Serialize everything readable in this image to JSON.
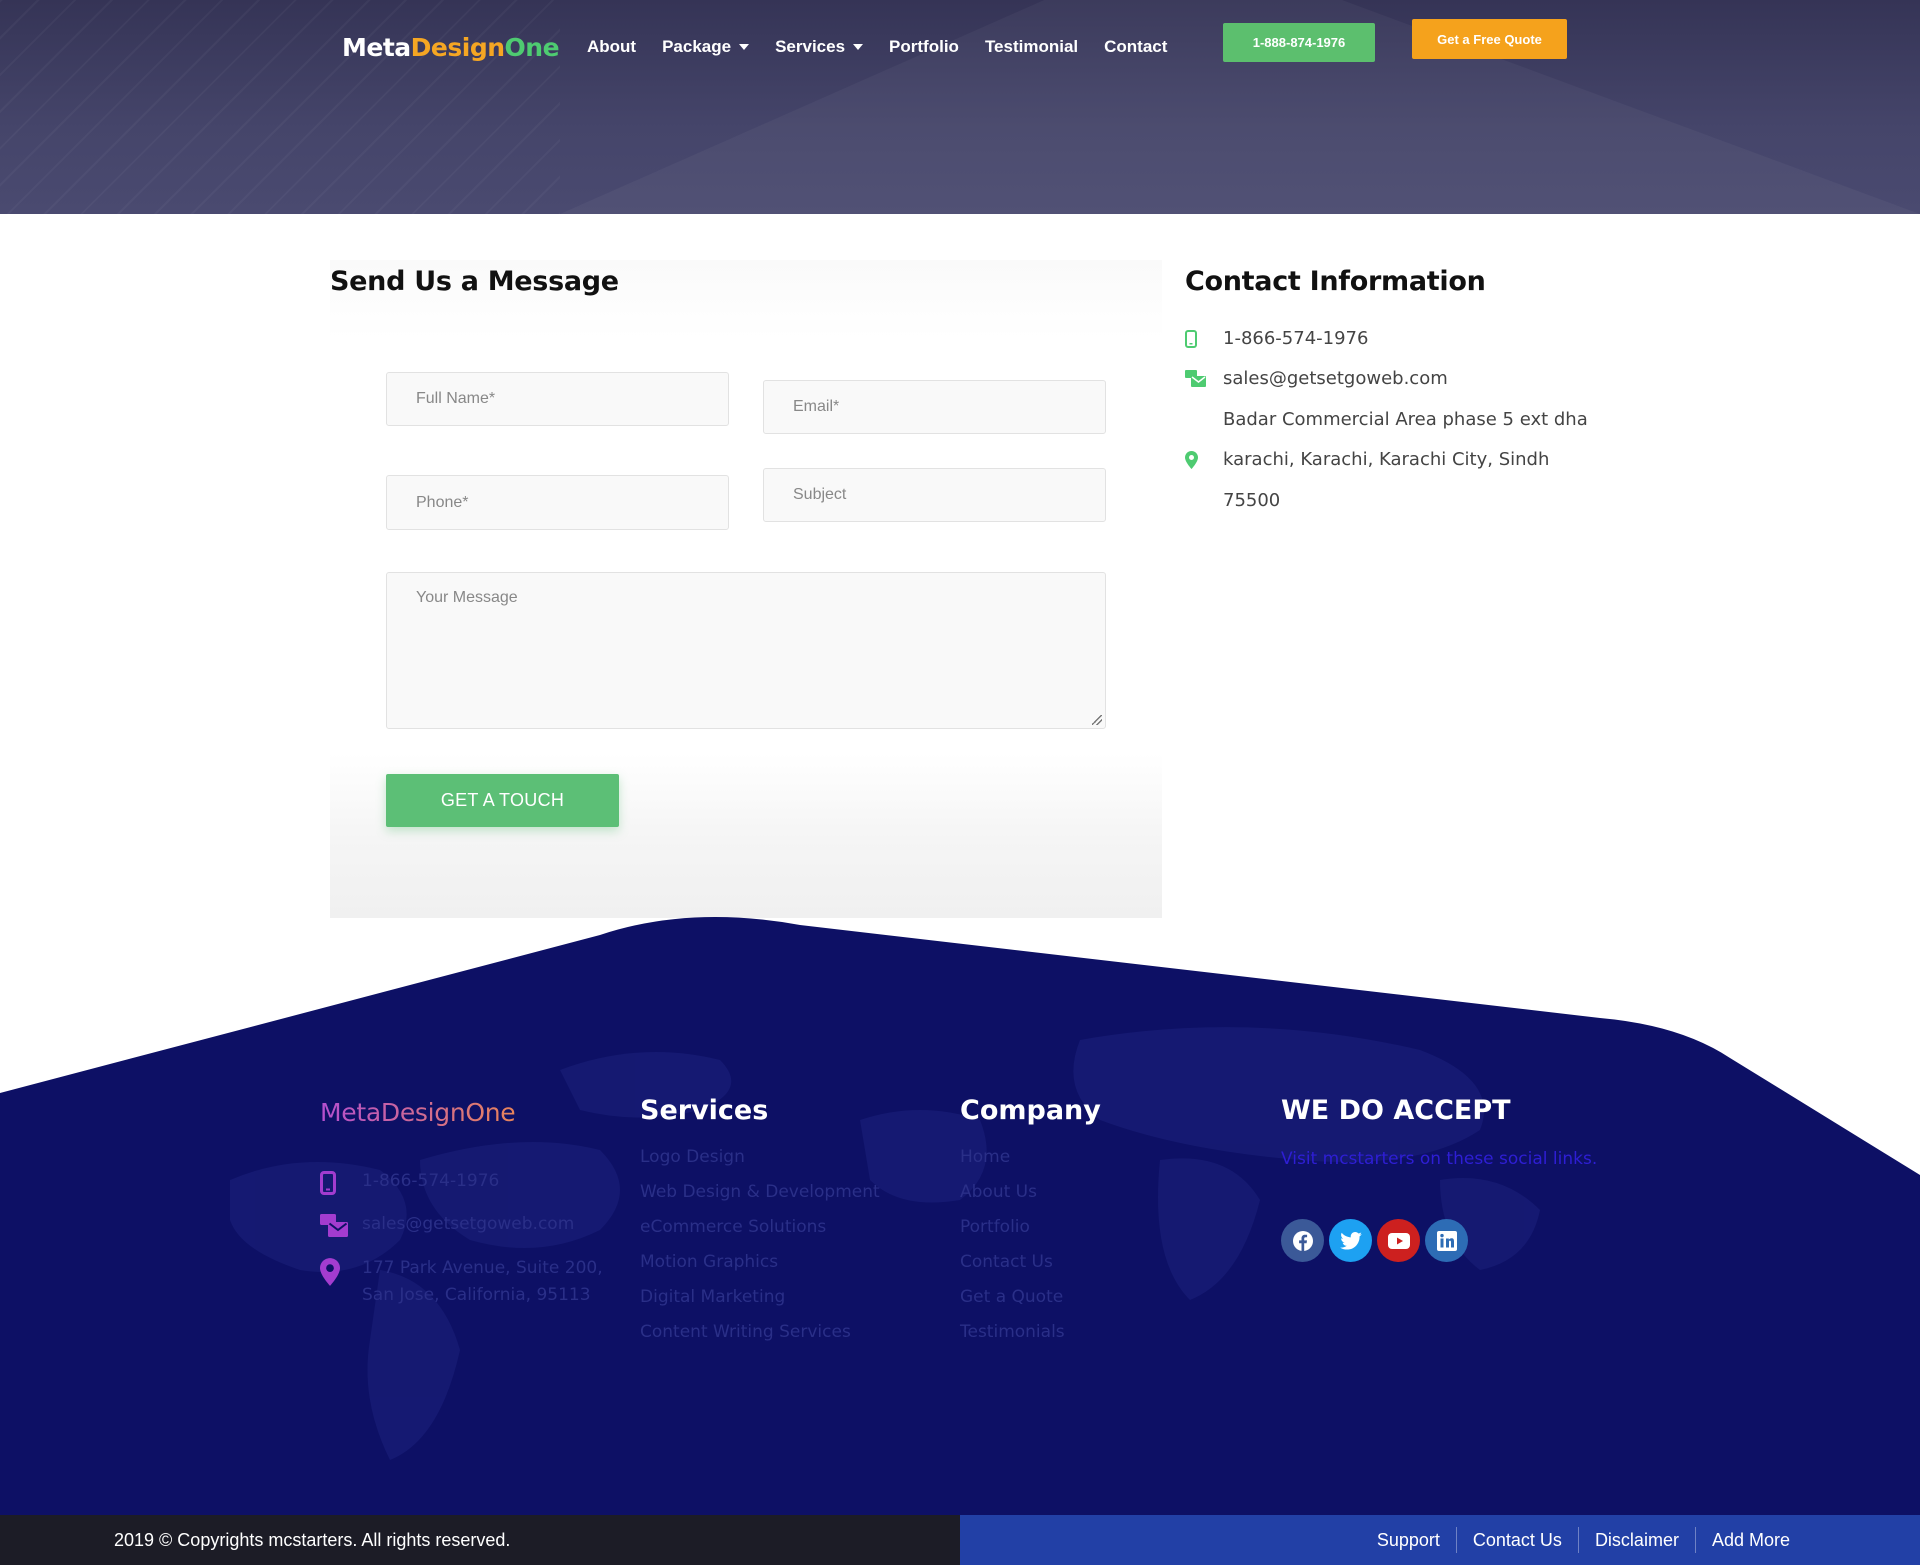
{
  "header": {
    "logo": {
      "part1": "Meta",
      "part2": "Design",
      "part3": "One"
    },
    "nav": [
      {
        "label": "About",
        "dropdown": false
      },
      {
        "label": "Package",
        "dropdown": true
      },
      {
        "label": "Services",
        "dropdown": true
      },
      {
        "label": "Portfolio",
        "dropdown": false
      },
      {
        "label": "Testimonial",
        "dropdown": false
      },
      {
        "label": "Contact",
        "dropdown": false
      }
    ],
    "phone_button": "1-888-874-1976",
    "quote_button": "Get a Free Quote"
  },
  "form": {
    "title": "Send Us a Message",
    "full_name_placeholder": "Full Name*",
    "email_placeholder": "Email*",
    "phone_placeholder": "Phone*",
    "subject_placeholder": "Subject",
    "message_placeholder": "Your Message",
    "submit_label": "GET A TOUCH"
  },
  "contact_info": {
    "title": "Contact Information",
    "phone": "1-866-574-1976",
    "email": "sales@getsetgoweb.com",
    "address_line1": "Badar Commercial Area phase 5 ext dha",
    "address_line2": "karachi, Karachi, Karachi City, Sindh",
    "address_line3": "75500"
  },
  "footer": {
    "logo": "MetaDesignOne",
    "phone": "1-866-574-1976",
    "email": "sales@getsetgoweb.com",
    "address_line1": "177 Park Avenue, Suite 200,",
    "address_line2": "San Jose, California, 95113",
    "services_title": "Services",
    "services": [
      "Logo Design",
      "Web Design & Development",
      "eCommerce Solutions",
      "Motion Graphics",
      "Digital Marketing",
      "Content Writing Services"
    ],
    "company_title": "Company",
    "company": [
      "Home",
      "About Us",
      "Portfolio",
      "Contact Us",
      "Get a Quote",
      "Testimonials"
    ],
    "accept_title": "WE DO ACCEPT",
    "accept_text": "Visit mcstarters on these social links.",
    "social": [
      {
        "icon": "facebook-icon",
        "color": "#3b5998"
      },
      {
        "icon": "twitter-icon",
        "color": "#1da1f2"
      },
      {
        "icon": "youtube-icon",
        "color": "#cd201f"
      },
      {
        "icon": "linkedin-icon",
        "color": "#0077b5"
      }
    ]
  },
  "bottom_bar": {
    "copyright": "2019 © Copyrights mcstarters. All rights reserved.",
    "links": [
      "Support",
      "Contact Us",
      "Disclaimer",
      "Add More"
    ]
  },
  "colors": {
    "header_bg": "#3f3f62",
    "accent_green": "#5cbf6e",
    "accent_orange": "#f5a21c",
    "footer_bg": "#0d1065",
    "bottom_left_bg": "#1c1c26",
    "bottom_right_bg": "#2240a6"
  }
}
